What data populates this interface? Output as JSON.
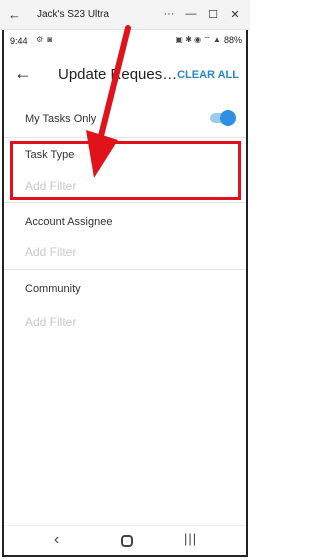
{
  "window": {
    "title": "Jack's S23 Ultra",
    "back_glyph": "←",
    "more_glyph": "···",
    "minimize_glyph": "—",
    "maximize_glyph": "☐",
    "close_glyph": "✕"
  },
  "status_bar": {
    "time": "9:44",
    "left_icons": "⚙ ◙",
    "right_icons": "▣ ✱ ◉ ⌔ ▲",
    "battery": "88%"
  },
  "header": {
    "back_glyph": "←",
    "title": "Update Requests...",
    "clear_all": "CLEAR ALL"
  },
  "filters": {
    "my_tasks_label": "My Tasks Only",
    "my_tasks_on": true,
    "task_type_label": "Task Type",
    "task_type_placeholder": "Add Filter",
    "account_assignee_label": "Account Assignee",
    "account_assignee_placeholder": "Add Filter",
    "community_label": "Community",
    "community_placeholder": "Add Filter"
  },
  "nav": {
    "back_glyph": "‹",
    "recent_glyph": "|||"
  },
  "colors": {
    "accent": "#2b84c6",
    "toggle_on": "#2f8fe0",
    "annotation": "#e0121b",
    "placeholder": "#c9c9c9"
  }
}
